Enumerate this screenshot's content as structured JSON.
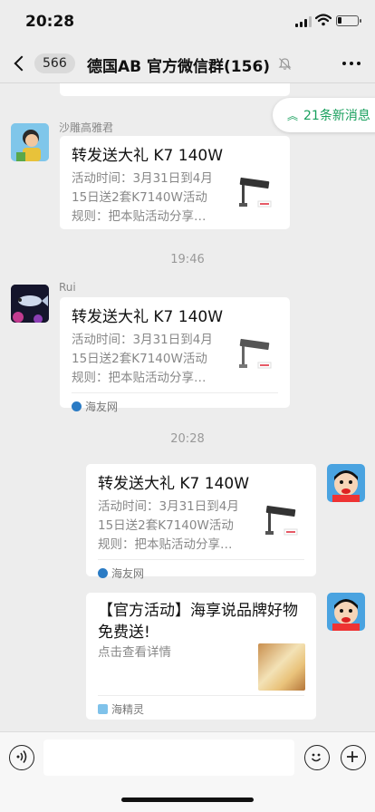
{
  "status": {
    "time": "20:28",
    "battery_level": 0.2
  },
  "nav": {
    "back_count": "566",
    "title": "德国AB  官方微信群(156)",
    "muted": true
  },
  "new_messages": {
    "label": "21条新消息"
  },
  "messages": [
    {
      "sender": "沙雕高雅君",
      "title": "转发送大礼 K7 140W",
      "desc": [
        "活动时间：3月31日到4月",
        "15日送2套K7140W活动",
        "规则：把本贴活动分享…"
      ]
    },
    {
      "timestamp": "19:46"
    },
    {
      "sender": "Rui",
      "title": "转发送大礼 K7 140W",
      "desc": [
        "活动时间：3月31日到4月",
        "15日送2套K7140W活动",
        "规则：把本贴活动分享…"
      ],
      "source": "海友网"
    },
    {
      "timestamp": "20:28"
    },
    {
      "title": "转发送大礼 K7 140W",
      "desc": [
        "活动时间：3月31日到4月",
        "15日送2套K7140W活动",
        "规则：把本贴活动分享…"
      ],
      "source": "海友网"
    },
    {
      "title_lines": [
        "【官方活动】海享说品牌好物",
        "免费送!"
      ],
      "desc": [
        "点击查看详情"
      ],
      "source": "海精灵"
    }
  ],
  "colors": {
    "accent": "#19a05e",
    "bg": "#ededed",
    "card": "#ffffff"
  }
}
